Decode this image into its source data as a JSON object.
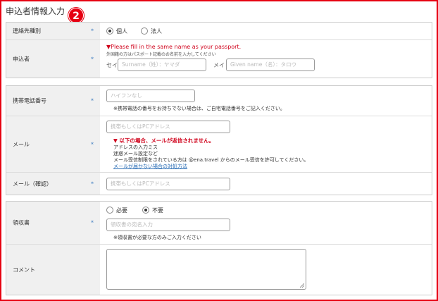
{
  "header": {
    "title": "申込者情報入力",
    "badge": "2"
  },
  "contact_type": {
    "label": "連絡先種別",
    "required_mark": "*",
    "options": [
      "個人",
      "法人"
    ],
    "selected": "個人"
  },
  "applicant": {
    "label": "申込者",
    "required_mark": "*",
    "notice": "▼Please fill in the same name as your passport.",
    "sub_notice": "外国籍の方はパスポート記載のお名前を入力してください",
    "sei_label": "セイ",
    "sei_placeholder": "Surname（姓）：ヤマダ",
    "mei_label": "メイ",
    "mei_placeholder": "Given name（名）：タロウ"
  },
  "mobile": {
    "label": "携帯電話番号",
    "required_mark": "*",
    "placeholder": "ハイフンなし",
    "note": "※携帯電話の番号をお持ちでない場合は、ご自宅電話番号をご記入ください。"
  },
  "email": {
    "label": "メール",
    "required_mark": "*",
    "placeholder": "携帯もしくはPCアドレス",
    "warning": "▼ 以下の場合、メールが返信されません。",
    "reasons": [
      "アドレスの入力ミス",
      "迷惑メール設定など",
      "メール受信制限をされている方は @ena.travel からのメール受信を許可してください。"
    ],
    "help_link": "メールが届かない場合の対処方法"
  },
  "email_confirm": {
    "label": "メール（確認）",
    "required_mark": "*",
    "placeholder": "携帯もしくはPCアドレス"
  },
  "receipt": {
    "label": "領収書",
    "required_mark": "*",
    "options": [
      "必要",
      "不要"
    ],
    "selected": "不要",
    "placeholder": "領収書の宛名入力",
    "note": "※領収書が必要な方のみご入力ください"
  },
  "comment": {
    "label": "コメント"
  },
  "colors": {
    "accent": "#e60012",
    "required": "#3a7bbf",
    "warning": "#d0021b",
    "link": "#2a6db5"
  }
}
